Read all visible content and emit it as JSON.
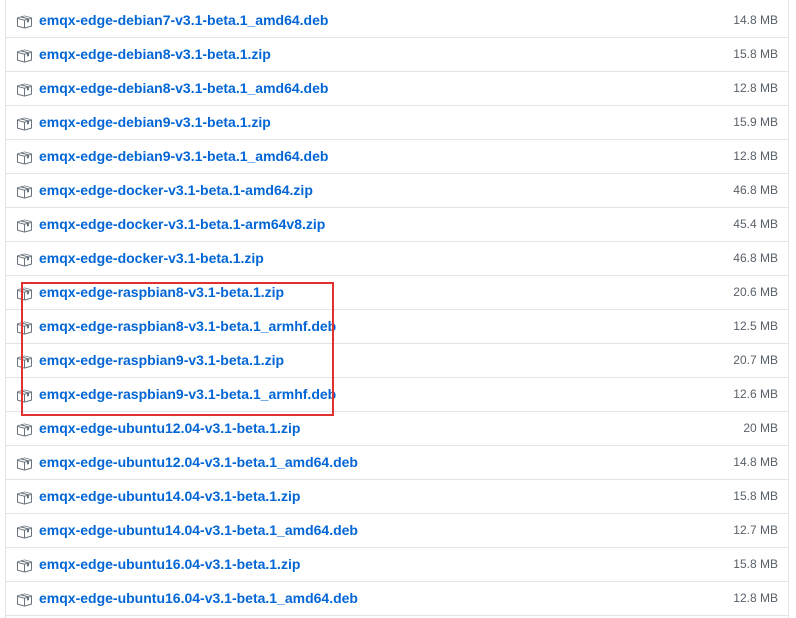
{
  "assets": [
    {
      "name": "emqx-edge-debian7-v3.1-beta.1_amd64.deb",
      "size": "14.8 MB",
      "icon": "package-icon"
    },
    {
      "name": "emqx-edge-debian8-v3.1-beta.1.zip",
      "size": "15.8 MB",
      "icon": "package-icon"
    },
    {
      "name": "emqx-edge-debian8-v3.1-beta.1_amd64.deb",
      "size": "12.8 MB",
      "icon": "package-icon"
    },
    {
      "name": "emqx-edge-debian9-v3.1-beta.1.zip",
      "size": "15.9 MB",
      "icon": "package-icon"
    },
    {
      "name": "emqx-edge-debian9-v3.1-beta.1_amd64.deb",
      "size": "12.8 MB",
      "icon": "package-icon"
    },
    {
      "name": "emqx-edge-docker-v3.1-beta.1-amd64.zip",
      "size": "46.8 MB",
      "icon": "package-icon"
    },
    {
      "name": "emqx-edge-docker-v3.1-beta.1-arm64v8.zip",
      "size": "45.4 MB",
      "icon": "package-icon"
    },
    {
      "name": "emqx-edge-docker-v3.1-beta.1.zip",
      "size": "46.8 MB",
      "icon": "package-icon"
    },
    {
      "name": "emqx-edge-raspbian8-v3.1-beta.1.zip",
      "size": "20.6 MB",
      "icon": "package-icon"
    },
    {
      "name": "emqx-edge-raspbian8-v3.1-beta.1_armhf.deb",
      "size": "12.5 MB",
      "icon": "package-icon"
    },
    {
      "name": "emqx-edge-raspbian9-v3.1-beta.1.zip",
      "size": "20.7 MB",
      "icon": "package-icon"
    },
    {
      "name": "emqx-edge-raspbian9-v3.1-beta.1_armhf.deb",
      "size": "12.6 MB",
      "icon": "package-icon"
    },
    {
      "name": "emqx-edge-ubuntu12.04-v3.1-beta.1.zip",
      "size": "20 MB",
      "icon": "package-icon"
    },
    {
      "name": "emqx-edge-ubuntu12.04-v3.1-beta.1_amd64.deb",
      "size": "14.8 MB",
      "icon": "package-icon"
    },
    {
      "name": "emqx-edge-ubuntu14.04-v3.1-beta.1.zip",
      "size": "15.8 MB",
      "icon": "package-icon"
    },
    {
      "name": "emqx-edge-ubuntu14.04-v3.1-beta.1_amd64.deb",
      "size": "12.7 MB",
      "icon": "package-icon"
    },
    {
      "name": "emqx-edge-ubuntu16.04-v3.1-beta.1.zip",
      "size": "15.8 MB",
      "icon": "package-icon"
    },
    {
      "name": "emqx-edge-ubuntu16.04-v3.1-beta.1_amd64.deb",
      "size": "12.8 MB",
      "icon": "package-icon"
    }
  ],
  "colors": {
    "link": "#0366d6",
    "size_text": "#586069",
    "border": "#e1e4e8",
    "highlight": "#e03131"
  }
}
